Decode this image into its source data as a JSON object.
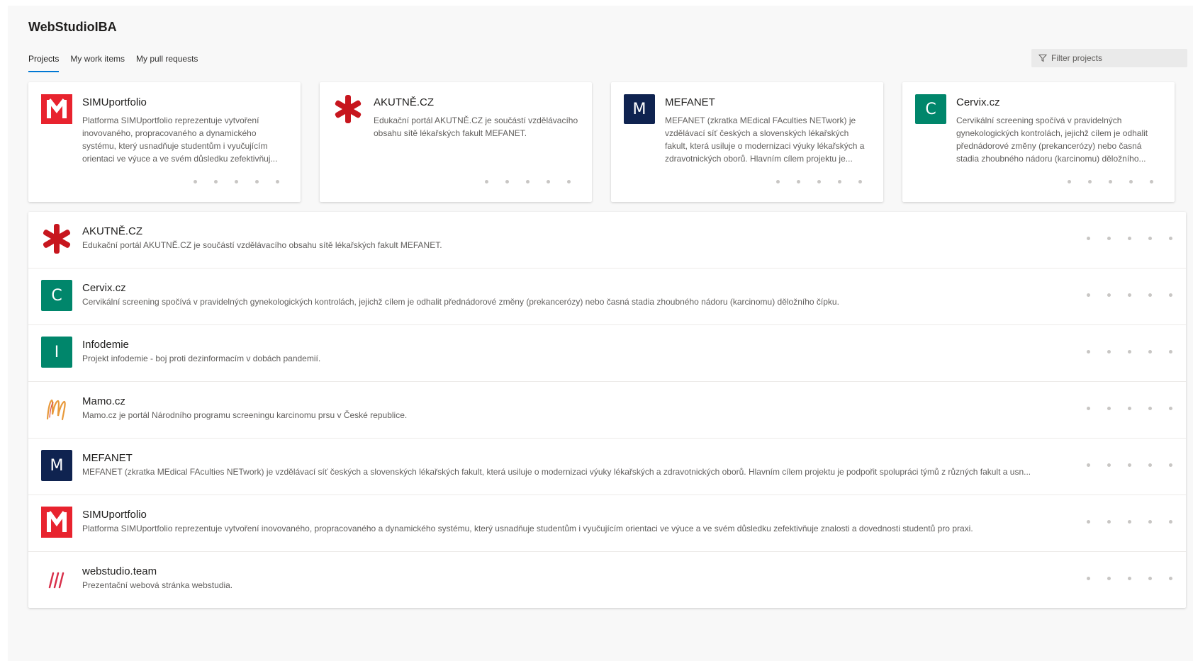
{
  "org": {
    "title": "WebStudioIBA"
  },
  "tabs": [
    {
      "label": "Projects",
      "active": true
    },
    {
      "label": "My work items",
      "active": false
    },
    {
      "label": "My pull requests",
      "active": false
    }
  ],
  "filter": {
    "placeholder": "Filter projects",
    "icon": "filter-icon"
  },
  "colors": {
    "accent": "#0078d4",
    "simu_red": "#e8232e",
    "teal": "#00866b",
    "navy": "#0f2350",
    "akutne_red": "#c7161e"
  },
  "cards": [
    {
      "name": "SIMUportfolio",
      "logo": "simuportfolio-logo",
      "description": "Platforma SIMUportfolio reprezentuje vytvoření inovovaného, propracovaného a dynamického systému, který usnadňuje studentům i vyučujícím orientaci ve výuce a ve svém důsledku zefektivňuj..."
    },
    {
      "name": "AKUTNĚ.CZ",
      "logo": "akutne-logo",
      "description": "Edukační portál AKUTNĚ.CZ je součástí vzdělávacího obsahu sítě lékařských fakult MEFANET."
    },
    {
      "name": "MEFANET",
      "logo": "letter-logo",
      "letter": "M",
      "description": "MEFANET (zkratka MEdical FAculties NETwork) je vzdělávací síť českých a slovenských lékařských fakult, která usiluje o modernizaci výuky lékařských a zdravotnických oborů. Hlavním cílem projektu je..."
    },
    {
      "name": "Cervix.cz",
      "logo": "letter-logo",
      "letter": "C",
      "description": "Cervikální screening spočívá v pravidelných gynekologických kontrolách, jejichž cílem je odhalit přednádorové změny (prekancerózy) nebo časná stadia zhoubného nádoru (karcinomu) děložního..."
    }
  ],
  "projects": [
    {
      "name": "AKUTNĚ.CZ",
      "logo": "akutne-logo",
      "description": "Edukační portál AKUTNĚ.CZ je součástí vzdělávacího obsahu sítě lékařských fakult MEFANET."
    },
    {
      "name": "Cervix.cz",
      "logo": "letter-logo",
      "letter": "C",
      "description": "Cervikální screening spočívá v pravidelných gynekologických kontrolách, jejichž cílem je odhalit přednádorové změny (prekancerózy) nebo časná stadia zhoubného nádoru (karcinomu) děložního čípku."
    },
    {
      "name": "Infodemie",
      "logo": "letter-logo",
      "letter": "I",
      "description": "Projekt infodemie - boj proti dezinformacím v dobách pandemií."
    },
    {
      "name": "Mamo.cz",
      "logo": "mamo-logo",
      "description": "Mamo.cz je portál Národního programu screeningu karcinomu prsu v České republice."
    },
    {
      "name": "MEFANET",
      "logo": "letter-logo",
      "letter": "M",
      "description": "MEFANET (zkratka MEdical FAculties NETwork) je vzdělávací síť českých a slovenských lékařských fakult, která usiluje o modernizaci výuky lékařských a zdravotnických oborů. Hlavním cílem projektu je podpořit spolupráci týmů z různých fakult a usn..."
    },
    {
      "name": "SIMUportfolio",
      "logo": "simuportfolio-logo",
      "description": "Platforma SIMUportfolio reprezentuje vytvoření inovovaného, propracovaného a dynamického systému, který usnadňuje studentům i vyučujícím orientaci ve výuce a ve svém důsledku zefektivňuje znalosti a dovednosti studentů pro praxi."
    },
    {
      "name": "webstudio.team",
      "logo": "webstudio-logo",
      "description": "Prezentační webová stránka webstudia."
    }
  ]
}
